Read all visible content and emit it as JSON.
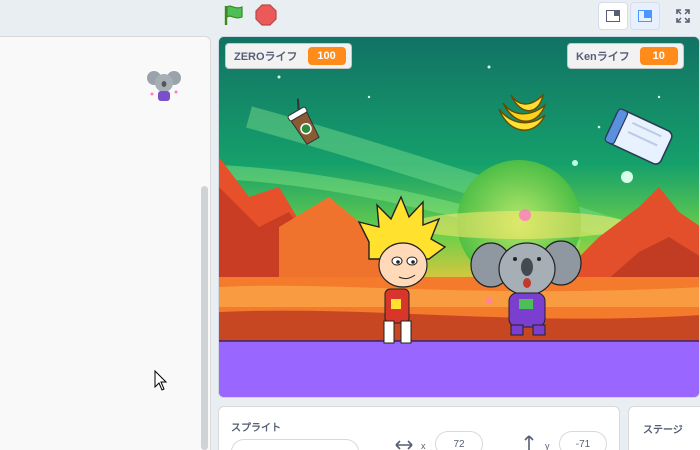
{
  "toolbar": {
    "green_flag_icon": "green-flag-icon",
    "stop_icon": "stop-icon",
    "layout_modes": [
      "small-stage-icon",
      "normal-stage-icon",
      "fullscreen-icon"
    ]
  },
  "monitors": [
    {
      "label": "ZEROライフ",
      "value": "100"
    },
    {
      "label": "Kenライフ",
      "value": "10"
    }
  ],
  "sprite_panel": {
    "title": "スプライト",
    "x_label": "x",
    "x_value": "72",
    "y_label": "y",
    "y_value": "-71"
  },
  "stage_panel": {
    "title": "ステージ"
  },
  "colors": {
    "accent_orange": "#ff8c1a",
    "ground_purple": "#9966ff"
  }
}
